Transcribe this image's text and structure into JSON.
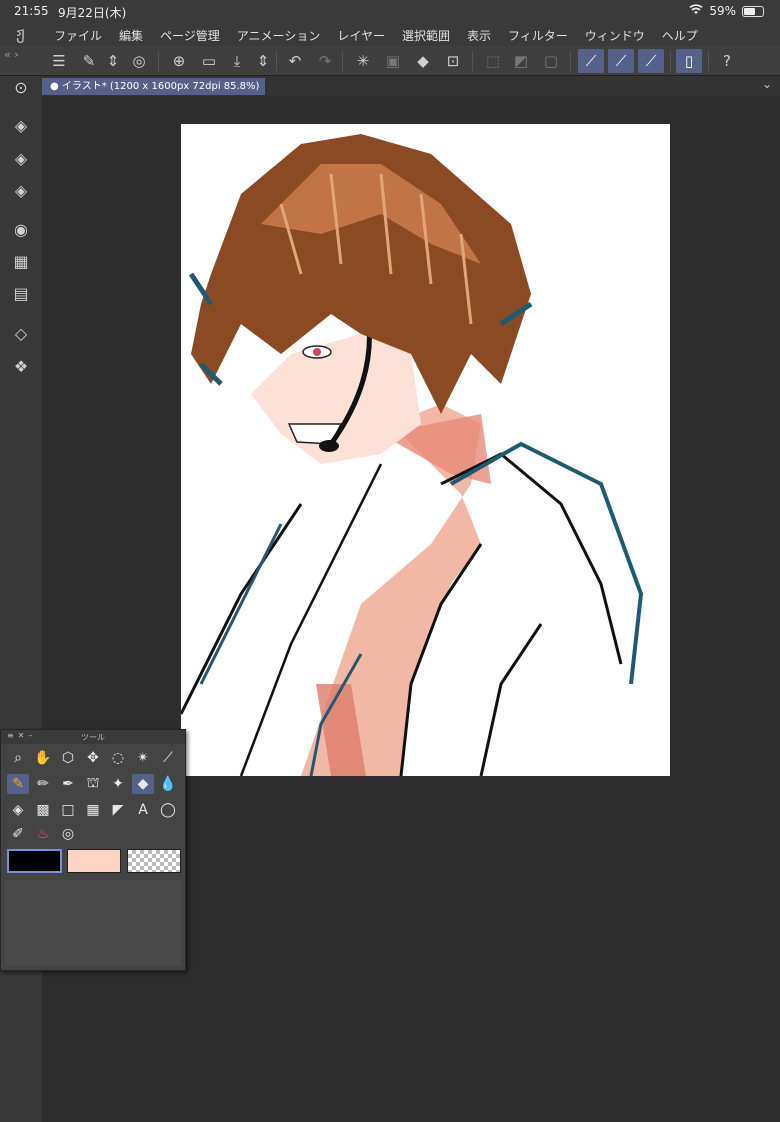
{
  "status": {
    "time": "21:55",
    "date": "9月22日(木)",
    "battery": "59%",
    "battery_level": 0.59,
    "wifi_icon": "wifi-icon"
  },
  "menu": {
    "items": [
      "ファイル",
      "編集",
      "ページ管理",
      "アニメーション",
      "レイヤー",
      "選択範囲",
      "表示",
      "フィルター",
      "ウィンドウ",
      "ヘルプ"
    ]
  },
  "tab": {
    "label": "● イラスト* (1200 x 1600px 72dpi 85.8%)"
  },
  "palette": {
    "title": "ツール",
    "colors": {
      "main": "#000000",
      "sub": "#fdd3c4"
    }
  },
  "colors": {
    "accent": "#56618a",
    "app_bg": "#2b2b2b",
    "panel": "#3f3f3f",
    "canvas": "#ffffff"
  }
}
